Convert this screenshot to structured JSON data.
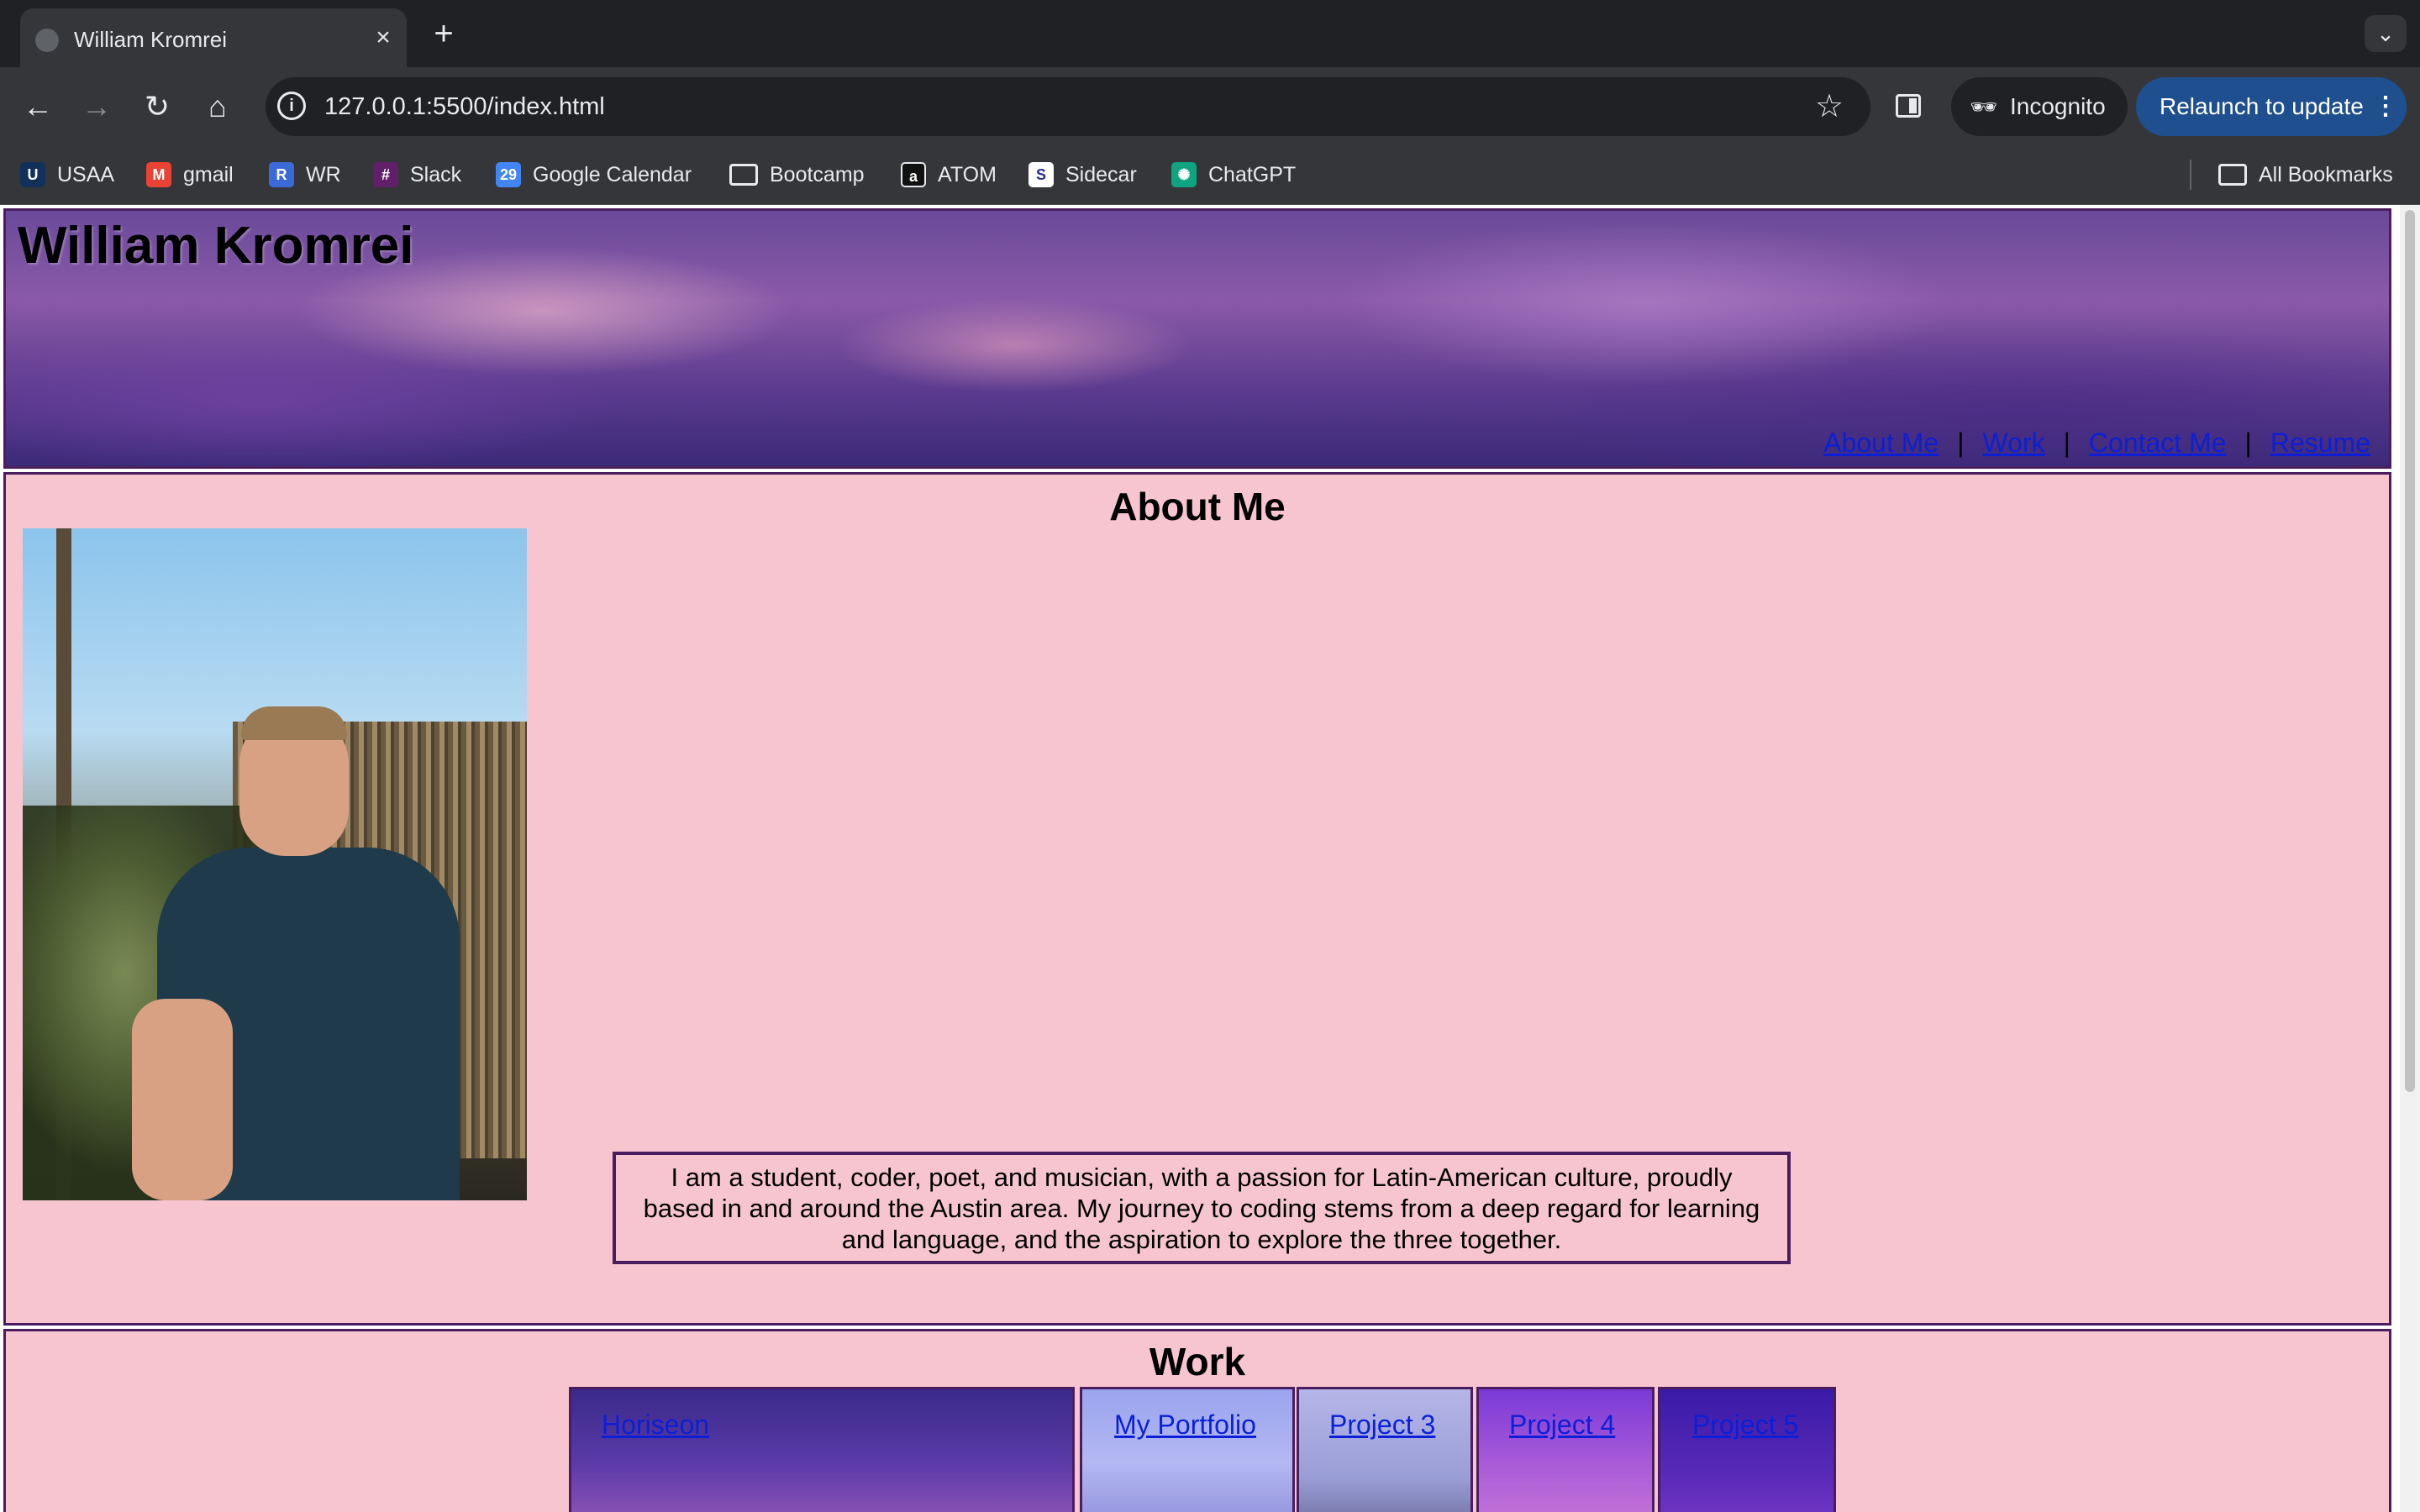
{
  "browser": {
    "tab_title": "William Kromrei",
    "url": "127.0.0.1:5500/index.html",
    "incognito_label": "Incognito",
    "relaunch_label": "Relaunch to update",
    "bookmarks": [
      {
        "label": "USAA",
        "icon": "usaa-icon",
        "color": "#12315a"
      },
      {
        "label": "gmail",
        "icon": "gmail-icon",
        "color": "#ea4335"
      },
      {
        "label": "WR",
        "icon": "wr-icon",
        "color": "#3b6ad8"
      },
      {
        "label": "Slack",
        "icon": "slack-icon",
        "color": "#611f69"
      },
      {
        "label": "Google Calendar",
        "icon": "calendar-icon",
        "color": "#4285f4"
      },
      {
        "label": "Bootcamp",
        "icon": "folder-icon",
        "color": "#e8eaed"
      },
      {
        "label": "ATOM",
        "icon": "atom-icon",
        "color": "#111111"
      },
      {
        "label": "Sidecar",
        "icon": "sidecar-icon",
        "color": "#2b2f8a"
      },
      {
        "label": "ChatGPT",
        "icon": "chatgpt-icon",
        "color": "#10a37f"
      }
    ],
    "all_bookmarks_label": "All Bookmarks"
  },
  "page": {
    "site_title": "William Kromrei",
    "nav": {
      "about": "About Me",
      "work": "Work",
      "contact": "Contact Me",
      "resume": "Resume",
      "separator": "|"
    },
    "about": {
      "heading": "About Me",
      "bio": "I am a student, coder, poet, and musician, with a passion for Latin-American culture, proudly based in and around the Austin area. My journey to coding stems from a deep regard for learning and language, and the aspiration to explore the three together."
    },
    "work": {
      "heading": "Work",
      "projects": [
        "Horiseon",
        "My Portfolio",
        "Project 3",
        "Project 4",
        "Project 5"
      ]
    }
  },
  "colors": {
    "accent_border": "#4b1d5f",
    "section_bg": "#f7c5cf",
    "link": "#0b1fd6"
  }
}
